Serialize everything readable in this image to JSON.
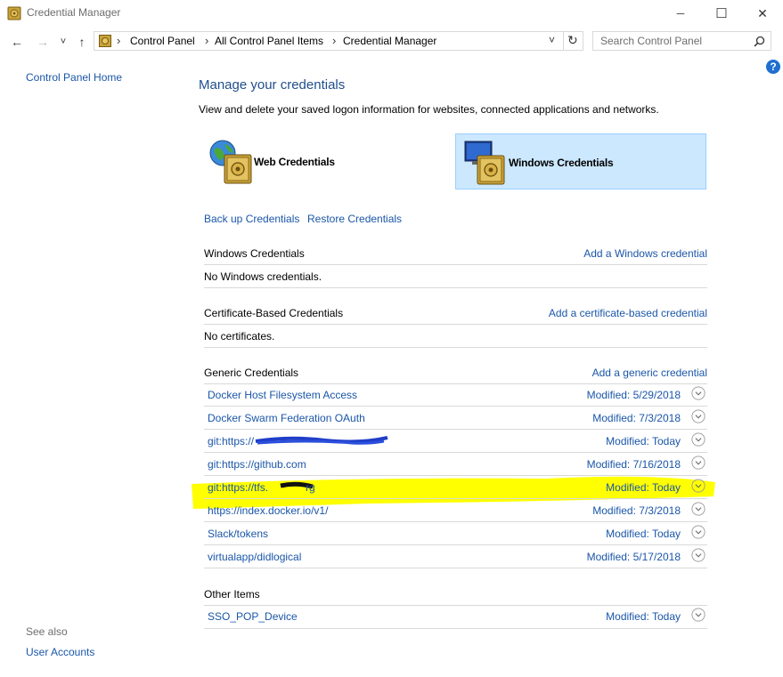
{
  "window": {
    "title": "Credential Manager",
    "minimize_glyph": "─",
    "maximize_glyph": "☐",
    "close_glyph": "✕"
  },
  "nav": {
    "back_glyph": "←",
    "forward_glyph": "→",
    "recent_glyph": "˅",
    "up_glyph": "↑",
    "breadcrumb": [
      "Control Panel",
      "All Control Panel Items",
      "Credential Manager"
    ],
    "separator": "›",
    "dropdown_glyph": "˅",
    "refresh_glyph": "↻"
  },
  "search": {
    "placeholder": "Search Control Panel"
  },
  "help_glyph": "?",
  "sidebar": {
    "home_link": "Control Panel Home",
    "see_also": "See also",
    "user_accounts": "User Accounts"
  },
  "main": {
    "heading": "Manage your credentials",
    "description": "View and delete your saved logon information for websites, connected applications and networks.",
    "tiles": {
      "web": "Web Credentials",
      "windows": "Windows Credentials"
    },
    "backup_link": "Back up Credentials",
    "restore_link": "Restore Credentials",
    "sections": {
      "windows": {
        "title": "Windows Credentials",
        "add": "Add a Windows credential",
        "empty": "No Windows credentials."
      },
      "certificate": {
        "title": "Certificate-Based Credentials",
        "add": "Add a certificate-based credential",
        "empty": "No certificates."
      },
      "generic": {
        "title": "Generic Credentials",
        "add": "Add a generic credential",
        "items": [
          {
            "name": "Docker Host Filesystem Access",
            "modified": "Modified:  5/29/2018"
          },
          {
            "name": "Docker Swarm Federation OAuth",
            "modified": "Modified:  7/3/2018"
          },
          {
            "name": "git:https://",
            "modified": "Modified:  Today"
          },
          {
            "name": "git:https://github.com",
            "modified": "Modified:  7/16/2018"
          },
          {
            "name": "git:https://tfs.",
            "modified": "Modified:  Today"
          },
          {
            "name": "https://index.docker.io/v1/",
            "modified": "Modified:  7/3/2018"
          },
          {
            "name": "Slack/tokens",
            "modified": "Modified:  Today"
          },
          {
            "name": "virtualapp/didlogical",
            "modified": "Modified:  5/17/2018"
          }
        ]
      },
      "other": {
        "title": "Other Items",
        "items": [
          {
            "name": "SSO_POP_Device",
            "modified": "Modified:  Today"
          }
        ]
      }
    }
  },
  "colors": {
    "link": "#1a56a8",
    "heading": "#1f4e8c",
    "tile_selected_bg": "#cce8ff",
    "tile_selected_border": "#99d1ff",
    "highlight": "#ffff00",
    "help": "#1f6fd0"
  }
}
